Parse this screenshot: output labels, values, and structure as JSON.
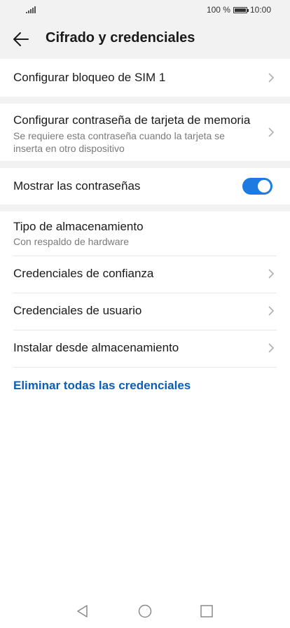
{
  "status_bar": {
    "battery_percent": "100 %",
    "time": "10:00"
  },
  "header": {
    "title": "Cifrado y credenciales"
  },
  "items": {
    "sim_lock": {
      "title": "Configurar bloqueo de SIM 1"
    },
    "memory_card_password": {
      "title": "Configurar contraseña de tarjeta de memoria",
      "subtitle": "Se requiere esta contraseña cuando la tarjeta se inserta en otro dispositivo"
    },
    "show_passwords": {
      "title": "Mostrar las contraseñas",
      "enabled": true
    },
    "storage_type": {
      "title": "Tipo de almacenamiento",
      "subtitle": "Con respaldo de hardware"
    },
    "trusted_credentials": {
      "title": "Credenciales de confianza"
    },
    "user_credentials": {
      "title": "Credenciales de usuario"
    },
    "install_from_storage": {
      "title": "Instalar desde almacenamiento"
    },
    "clear_credentials": {
      "title": "Eliminar todas las credenciales"
    }
  },
  "colors": {
    "accent": "#1d7ae0",
    "link": "#0a5fb4",
    "background_gap": "#f2f2f2"
  },
  "icons": [
    "signal-icon",
    "battery-icon",
    "back-arrow-icon",
    "chevron-right-icon",
    "nav-back-icon",
    "nav-home-icon",
    "nav-recents-icon"
  ]
}
